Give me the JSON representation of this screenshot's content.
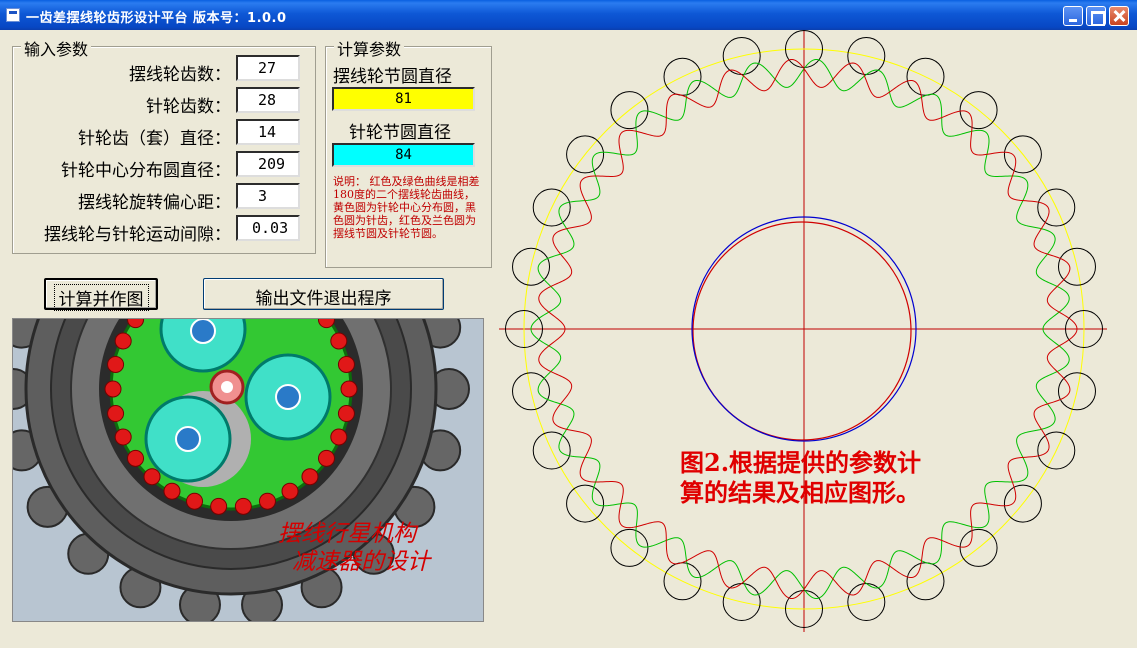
{
  "window": {
    "title": "一齿差摆线轮齿形设计平台   版本号：1.0.0"
  },
  "input_group": {
    "title": "输入参数",
    "rows": [
      {
        "label": "摆线轮齿数：",
        "value": "27"
      },
      {
        "label": "针轮齿数：",
        "value": "28"
      },
      {
        "label": "针轮齿（套）直径：",
        "value": "14"
      },
      {
        "label": "针轮中心分布圆直径：",
        "value": "209"
      },
      {
        "label": "摆线轮旋转偏心距：",
        "value": "3"
      },
      {
        "label": "摆线轮与针轮运动间隙：",
        "value": "0.03"
      }
    ]
  },
  "calc_group": {
    "title": "计算参数",
    "cycloid_pitch_label": "摆线轮节圆直径",
    "cycloid_pitch_value": "81",
    "cycloid_pitch_color": "#ffff00",
    "pin_pitch_label": "针轮节圆直径",
    "pin_pitch_value": "84",
    "pin_pitch_color": "#00ffff",
    "note": "说明： 红色及绿色曲线是相差180度的二个摆线轮齿曲线，黄色圆为针轮中心分布圆，黑色圆为针齿，红色及兰色圆为摆线节圆及针轮节圆。"
  },
  "buttons": {
    "calc_label": "计算并作图",
    "exit_label": "输出文件退出程序"
  },
  "gear_image": {
    "caption_line1": "摆线行星机构",
    "caption_line2": "减速器的设计"
  },
  "drawing": {
    "caption": "图2.根据提供的参数计算的结果及相应图形。",
    "pin_count": 28,
    "colors": {
      "pin": "#000000",
      "pin_distribution_circle": "#ffff00",
      "curve_a": "#d00000",
      "curve_b": "#00c000",
      "pitch_red": "#d00000",
      "pitch_blue": "#0000d0",
      "axes": "#c00000"
    }
  }
}
